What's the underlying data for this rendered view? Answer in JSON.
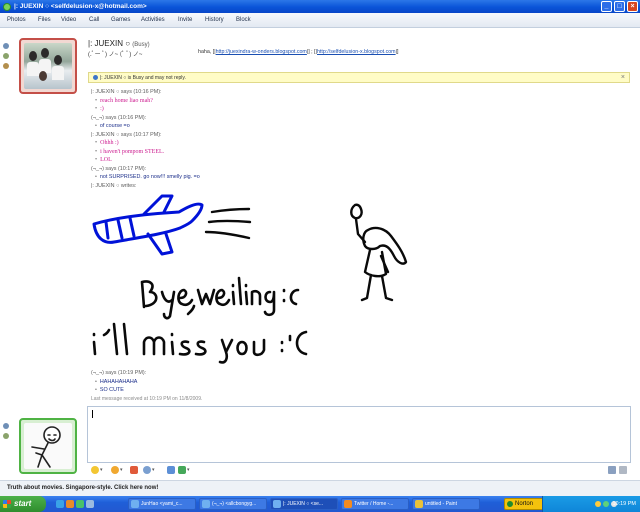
{
  "window": {
    "title": "|: JUEXIN ○ <selfdelusion-x@hotmail.com>",
    "minimize": "_",
    "maximize": "□",
    "close": "×"
  },
  "menu": [
    "Photos",
    "Files",
    "Video",
    "Call",
    "Games",
    "Activities",
    "Invite",
    "History",
    "Block"
  ],
  "contact": {
    "name": "|: JUEXIN ○",
    "status": "(Busy)",
    "psm": "(.ﾟー ﾟ) ノ~ (ﾟ ﾟ) ノ~",
    "links_prefix": "haha, [|",
    "link1": "http://juexindra-w-onders.blogspot.com",
    "links_mid": "|] ; [|",
    "link2": "http://selfdelusion-x.blogspot.com",
    "links_suffix": "|]"
  },
  "infobar": {
    "text": "|: JUEXIN ○ is Busy and may not reply.",
    "close": "×"
  },
  "conversation": [
    {
      "cls": "say",
      "text": "|: JUEXIN ○ says (10:16 PM):"
    },
    {
      "cls": "msg-p",
      "text": "reach home liao mah?"
    },
    {
      "cls": "msg-p",
      "text": ":)"
    },
    {
      "cls": "say",
      "text": "(¬_¬) says (10:16 PM):"
    },
    {
      "cls": "msg-b",
      "text": "of course =o"
    },
    {
      "cls": "say",
      "text": "|: JUEXIN ○ says (10:17 PM):"
    },
    {
      "cls": "msg-p",
      "text": "Ohhh :)"
    },
    {
      "cls": "msg-p",
      "text": "i haven't pompom STEEL."
    },
    {
      "cls": "msg-p",
      "text": "LOL"
    },
    {
      "cls": "say",
      "text": "(¬_¬) says (10:17 PM):"
    },
    {
      "cls": "msg-b",
      "text": "not SURPRISED. go now!!! smelly pig. =o"
    },
    {
      "cls": "say",
      "text": "|: JUEXIN ○ writes:"
    }
  ],
  "handwriting": {
    "line1": "Bye,weiling :C",
    "line2": "i'll miss you :'C"
  },
  "conversation2": [
    {
      "cls": "say",
      "text": "(¬_¬) says (10:19 PM):"
    },
    {
      "cls": "msg-b",
      "text": "HAHAHAHAHA"
    },
    {
      "cls": "msg-b",
      "text": "SO CUTE"
    },
    {
      "cls": "lastmsg",
      "text": "Last message received at 10:19 PM on 11/8/2009."
    }
  ],
  "ad": {
    "text": "Truth about movies. Singapore-style. Click here now!"
  },
  "taskbar": {
    "start": "start",
    "tasks": [
      {
        "label": "JunHao <yami_c...",
        "active": false,
        "color": "#6fb0f0"
      },
      {
        "label": "(¬_¬) <allcbongyg...",
        "active": false,
        "color": "#6fb0f0"
      },
      {
        "label": "|: JUEXIN ○ <se...",
        "active": true,
        "color": "#6fb0f0"
      },
      {
        "label": "Twitter / Home -...",
        "active": false,
        "color": "#f38b1f"
      },
      {
        "label": "untitled - Paint",
        "active": false,
        "color": "#e9c23a"
      }
    ],
    "norton": "Norton",
    "clock": "10:19 PM"
  },
  "colors": {
    "accent": "#0a54d8",
    "ink": "#0012d8",
    "contact_msg": "#cc1a8e",
    "my_msg": "#1b2e8a"
  }
}
